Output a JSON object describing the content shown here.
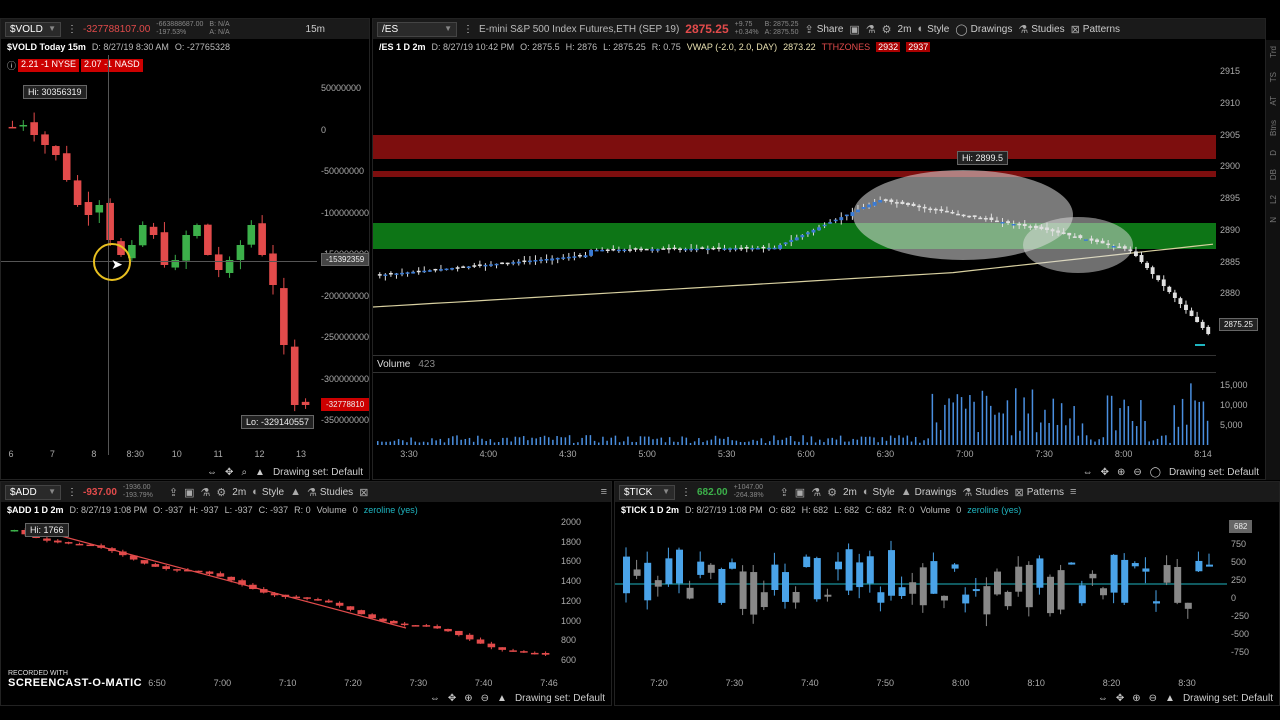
{
  "vold": {
    "symbol": "$VOLD",
    "last": "-327788107.00",
    "bidask_top": "-663888687.00",
    "bidask_bot": "-197.53%",
    "bidsize_top": "B: N/A",
    "bidsize_bot": "A: N/A",
    "timeframe": "15m",
    "title": "$VOLD Today 15m",
    "date": "D: 8/27/19 8:30 AM",
    "open": "O: -27765328",
    "tick1": "2.21 -1 NYSE",
    "tick2": "2.07 -1 NASD",
    "hi": "Hi: 30356319",
    "lo": "Lo: -329140557",
    "cursor_value": "-15392359",
    "last_tag": "-32778810",
    "footer": "Drawing set: Default",
    "xlabels": [
      "6",
      "7",
      "8",
      "8:30",
      "10",
      "11",
      "12",
      "13"
    ],
    "ylabels": [
      "50000000",
      "0",
      "-50000000",
      "-100000000",
      "-150000000",
      "-200000000",
      "-250000000",
      "-300000000",
      "-350000000"
    ]
  },
  "es": {
    "symbol": "/ES",
    "description": "E-mini S&P 500 Index Futures,ETH (SEP 19)",
    "price": "2875.25",
    "change_top": "+9.75",
    "change_bot": "+0.34%",
    "bid": "B: 2875.25",
    "ask": "A: 2875.50",
    "title": "/ES 1 D 2m",
    "date": "D: 8/27/19 10:42 PM",
    "open": "O: 2875.5",
    "high": "H: 2876",
    "low": "L: 2875.25",
    "range": "R: 0.75",
    "vwap": "VWAP (-2.0, 2.0, DAY)",
    "vwap_val": "2873.22",
    "ttz": "TTHZONES",
    "ttz_val1": "2932",
    "ttz_val2": "2937",
    "share": "Share",
    "tf": "2m",
    "style": "Style",
    "drawings": "Drawings",
    "studies": "Studies",
    "patterns": "Patterns",
    "hi_label": "Hi: 2899.5",
    "last_tag": "2875.25",
    "volume_label": "Volume",
    "volume_val": "423",
    "footer": "Drawing set: Default",
    "ylabels": [
      "2915",
      "2910",
      "2905",
      "2900",
      "2895",
      "2890",
      "2885",
      "2880",
      "2875"
    ],
    "vol_ylabels": [
      "15,000",
      "10,000",
      "5,000"
    ],
    "xlabels": [
      "3:30",
      "4:00",
      "4:30",
      "5:00",
      "5:30",
      "6:00",
      "6:30",
      "7:00",
      "7:30",
      "8:00",
      "8:14"
    ],
    "sidebar": [
      "Trd",
      "TS",
      "AT",
      "Btns",
      "D",
      "DB",
      "L2",
      "N"
    ]
  },
  "add": {
    "symbol": "$ADD",
    "last": "-937.00",
    "change_top": "-1936.00",
    "change_bot": "-193.79%",
    "title": "$ADD 1 D 2m",
    "date": "D: 8/27/19 1:08 PM",
    "open": "O: -937",
    "high": "H: -937",
    "low": "L: -937",
    "close": "C: -937",
    "range": "R: 0",
    "volume_label": "Volume",
    "volume_val": "0",
    "zeroline": "zeroline (yes)",
    "tf": "2m",
    "style": "Style",
    "studies": "Studies",
    "hi": "Hi: 1766",
    "footer": "Drawing set: Default",
    "ylabels": [
      "2000",
      "1800",
      "1600",
      "1400",
      "1200",
      "1000",
      "800",
      "600"
    ],
    "xlabels": [
      "6:50",
      "7:00",
      "7:10",
      "7:20",
      "7:30",
      "7:40",
      "7:46"
    ]
  },
  "tick": {
    "symbol": "$TICK",
    "last": "682.00",
    "change_top": "+1047.00",
    "change_bot": "-264.38%",
    "title": "$TICK 1 D 2m",
    "date": "D: 8/27/19 1:08 PM",
    "open": "O: 682",
    "high": "H: 682",
    "low": "L: 682",
    "close": "C: 682",
    "range": "R: 0",
    "volume_label": "Volume",
    "volume_val": "0",
    "zeroline": "zeroline (yes)",
    "tf": "2m",
    "style": "Style",
    "drawings": "Drawings",
    "studies": "Studies",
    "patterns": "Patterns",
    "last_tag": "682",
    "footer": "Drawing set: Default",
    "ylabels": [
      "750",
      "500",
      "250",
      "0",
      "-250",
      "-500",
      "-750"
    ],
    "xlabels": [
      "7:20",
      "7:30",
      "7:40",
      "7:50",
      "8:00",
      "8:10",
      "8:20",
      "8:30"
    ]
  },
  "watermark": {
    "line1": "RECORDED WITH",
    "line2": "SCREENCAST-O-MATIC"
  },
  "colors": {
    "up": "#3cb04a",
    "down": "#e24b4b",
    "es_up": "#3a7bd5",
    "vwap": "#d8d0a0",
    "zone_red": "#8b1010",
    "zone_green": "#0f8a1a",
    "zeroline": "#1fb5c0"
  }
}
